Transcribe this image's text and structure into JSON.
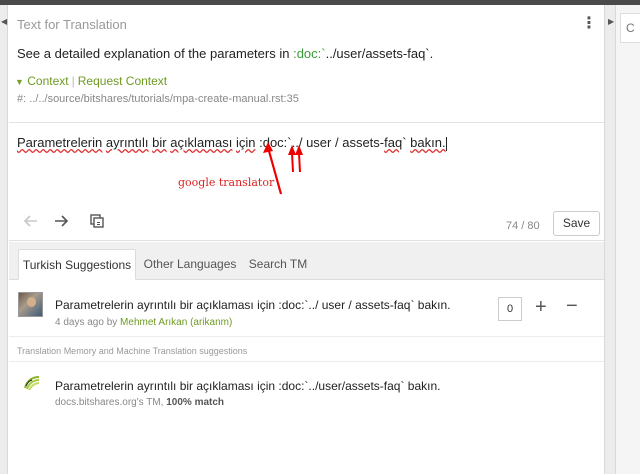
{
  "source": {
    "title": "Text for Translation",
    "text_before": "See a detailed explanation of the parameters in ",
    "text_code": ":doc:`",
    "text_after": "../user/assets-faq`.",
    "context_label": "Context",
    "request_context_label": "Request Context",
    "location": "#: ../../source/bitshares/tutorials/mpa-create-manual.rst:35"
  },
  "editor": {
    "word1": "Parametrelerin",
    "word2": "ayrıntılı",
    "word3": "bir",
    "word4": "açıklaması",
    "word5": "için",
    "mid1": " :doc:`../ ",
    "word6": "user",
    "mid2": " / assets-",
    "word7": "faq",
    "end1": "` ",
    "word8": "bakın.",
    "annotation": "google translator"
  },
  "toolbar": {
    "counter": "74 / 80",
    "save_label": "Save"
  },
  "tabs": [
    {
      "label": "Turkish Suggestions"
    },
    {
      "label": "Other Languages"
    },
    {
      "label": "Search TM"
    }
  ],
  "suggestion": {
    "text": "Parametrelerin ayrıntılı bir açıklaması için :doc:`../ user / assets-faq` bakın.",
    "time": "4 days ago by ",
    "author": "Mehmet Arıkan (arikanm)",
    "votes": "0"
  },
  "tm": {
    "header": "Translation Memory and Machine Translation suggestions",
    "text": "Parametrelerin ayrıntılı bir açıklaması için :doc:`../user/assets-faq` bakın.",
    "source": "docs.bitshares.org's TM, ",
    "match": "100% match"
  },
  "colors": {
    "accent_green": "#6f9a24",
    "annotation_red": "#d22"
  },
  "icons": {
    "prev": "arrow-left-icon",
    "next": "arrow-right-icon",
    "copy": "copy-source-icon",
    "menu": "kebab-menu-icon"
  }
}
